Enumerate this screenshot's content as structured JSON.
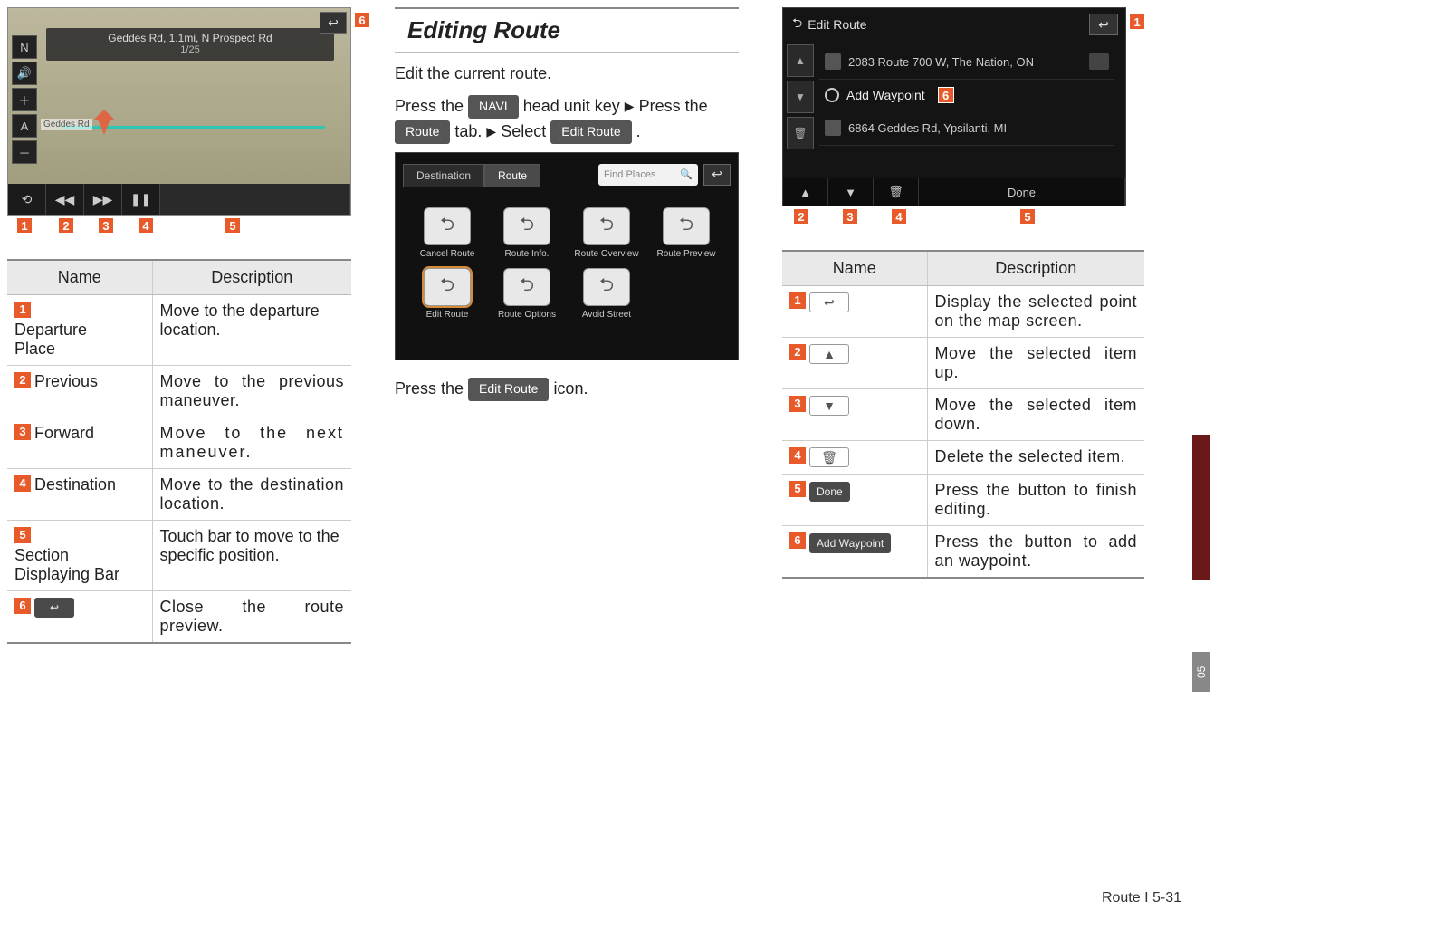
{
  "col1": {
    "map": {
      "top_line1": "Geddes Rd, 1.1mi, N Prospect Rd",
      "top_line2": "1/25",
      "road_label": "Geddes Rd",
      "side_buttons": [
        "N",
        "🔊",
        "＋",
        "A",
        "－"
      ],
      "return_glyph": "↩",
      "bottom_controls": [
        "⟲",
        "◀◀",
        "▶▶",
        "❚❚"
      ]
    },
    "callouts_below": [
      "1",
      "2",
      "3",
      "4",
      "5"
    ],
    "callout_return": "6",
    "table": {
      "headers": [
        "Name",
        "Description"
      ],
      "rows": [
        {
          "n": "1",
          "name": "Departure Place",
          "desc": "Move to the departure location."
        },
        {
          "n": "2",
          "name": "Previous",
          "desc": "Move to the previous maneuver."
        },
        {
          "n": "3",
          "name": "Forward",
          "desc": "Move to the next maneuver."
        },
        {
          "n": "4",
          "name": "Destination",
          "desc": "Move to the destination location."
        },
        {
          "n": "5",
          "name": "Section Displaying Bar",
          "desc": "Touch bar to move to the specific position."
        },
        {
          "n": "6",
          "name_icon": "↩",
          "desc": "Close the route preview."
        }
      ]
    }
  },
  "col2": {
    "title": "Editing Route",
    "p1": "Edit the current route.",
    "p2_a": "Press the ",
    "p2_key1": "NAVI",
    "p2_b": " head unit key ",
    "p2_c": " Press the ",
    "p2_key2": "Route",
    "p2_d": " tab. ",
    "p2_e": " Select ",
    "p2_key3": "Edit Route",
    "p2_f": " .",
    "shot": {
      "tab1": "Destination",
      "tab2": "Route",
      "search_placeholder": "Find Places",
      "items": [
        {
          "icon": "⮌✖",
          "label": "Cancel Route"
        },
        {
          "icon": "⮌",
          "label": "Route Info."
        },
        {
          "icon": "⮌",
          "label": "Route Overview"
        },
        {
          "icon": "⮌",
          "label": "Route Preview"
        },
        {
          "icon": "⮌",
          "label": "Edit Route",
          "sel": true
        },
        {
          "icon": "⮌",
          "label": "Route Options"
        },
        {
          "icon": "⮌",
          "label": "Avoid Street"
        }
      ]
    },
    "p3_a": "Press the ",
    "p3_key": "Edit Route",
    "p3_b": " icon."
  },
  "col3": {
    "shot": {
      "title_icon": "⮌",
      "title": "Edit Route",
      "return_glyph": "↩",
      "row1": "2083 Route 700 W, The Nation, ON",
      "add_waypoint": "Add Waypoint",
      "row2": "6864 Geddes Rd, Ypsilanti, MI",
      "side_buttons": [
        "▲",
        "▼",
        "🗑"
      ],
      "done": "Done"
    },
    "callout_return": "1",
    "callout_add": "6",
    "callouts_below": [
      "2",
      "3",
      "4",
      "5"
    ],
    "table": {
      "headers": [
        "Name",
        "Description"
      ],
      "rows": [
        {
          "n": "1",
          "icon": "↩",
          "icon_style": "outline",
          "desc": "Display the selected point on the map screen."
        },
        {
          "n": "2",
          "icon": "▲",
          "icon_style": "outline",
          "desc": "Move the selected item up."
        },
        {
          "n": "3",
          "icon": "▼",
          "icon_style": "outline",
          "desc": "Move the selected item down."
        },
        {
          "n": "4",
          "icon": "🗑",
          "icon_style": "outline",
          "desc": "Delete the selected item."
        },
        {
          "n": "5",
          "icon": "Done",
          "icon_style": "dark",
          "desc": "Press the button to finish editing."
        },
        {
          "n": "6",
          "icon": "Add Waypoint",
          "icon_style": "dark",
          "desc": "Press the button to add an waypoint."
        }
      ]
    }
  },
  "side_label": "05",
  "footer": "Route I 5-31"
}
